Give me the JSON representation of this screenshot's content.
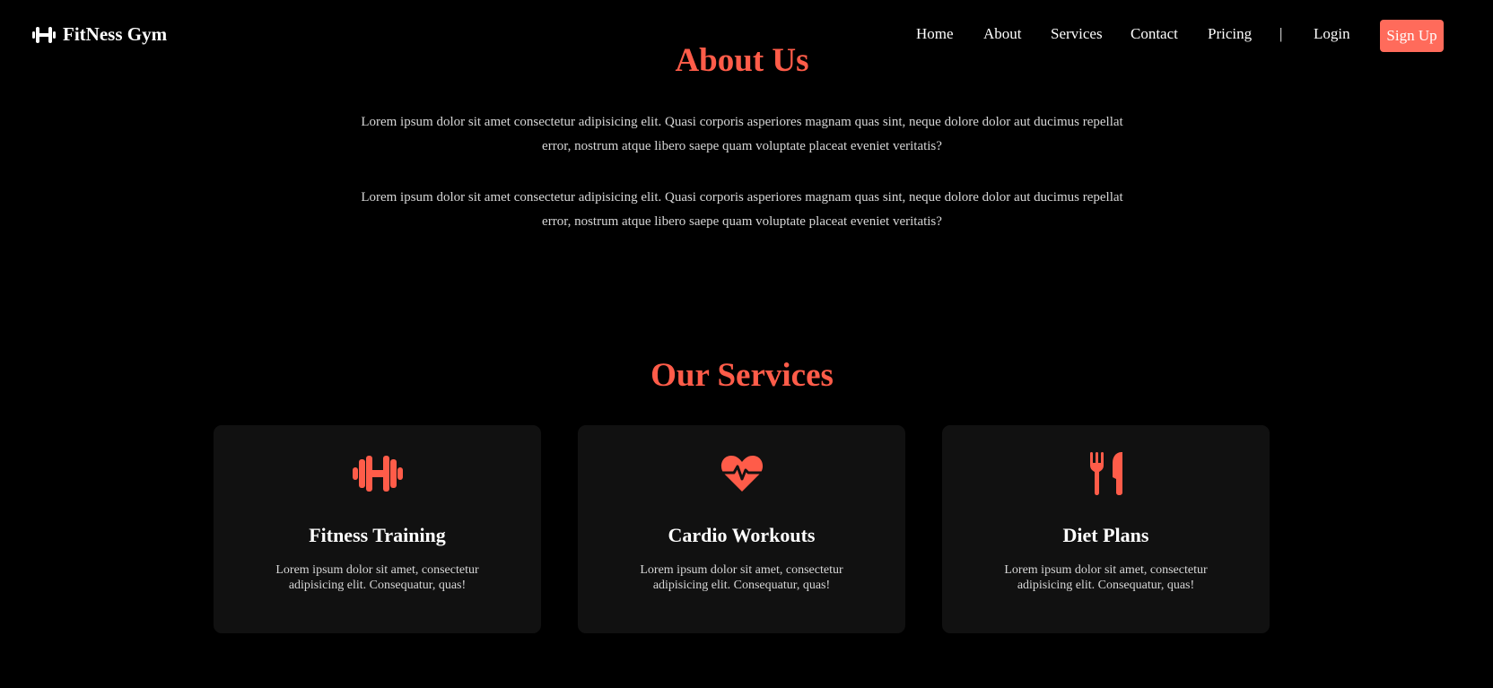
{
  "brand": {
    "name": "FitNess Gym",
    "icon": "dumbbell-icon"
  },
  "nav": {
    "links": [
      {
        "label": "Home"
      },
      {
        "label": "About"
      },
      {
        "label": "Services"
      },
      {
        "label": "Contact"
      },
      {
        "label": "Pricing"
      }
    ],
    "separator": "|",
    "login": "Login",
    "signup": "Sign Up"
  },
  "about": {
    "title": "About Us",
    "paragraphs": [
      "Lorem ipsum dolor sit amet consectetur adipisicing elit. Quasi corporis asperiores magnam quas sint, neque dolore dolor aut ducimus repellat error, nostrum atque libero saepe quam voluptate placeat eveniet veritatis?",
      "Lorem ipsum dolor sit amet consectetur adipisicing elit. Quasi corporis asperiores magnam quas sint, neque dolore dolor aut ducimus repellat error, nostrum atque libero saepe quam voluptate placeat eveniet veritatis?"
    ]
  },
  "services": {
    "title": "Our Services",
    "cards": [
      {
        "icon": "dumbbell-icon",
        "title": "Fitness Training",
        "text": "Lorem ipsum dolor sit amet, consectetur adipisicing elit. Consequatur, quas!"
      },
      {
        "icon": "heartbeat-icon",
        "title": "Cardio Workouts",
        "text": "Lorem ipsum dolor sit amet, consectetur adipisicing elit. Consequatur, quas!"
      },
      {
        "icon": "utensils-icon",
        "title": "Diet Plans",
        "text": "Lorem ipsum dolor sit amet, consectetur adipisicing elit. Consequatur, quas!"
      }
    ]
  },
  "colors": {
    "background": "#000000",
    "accent": "#ff5c49",
    "button": "#ff6b5b",
    "card": "#111111",
    "body_text": "#d6d6d6"
  }
}
